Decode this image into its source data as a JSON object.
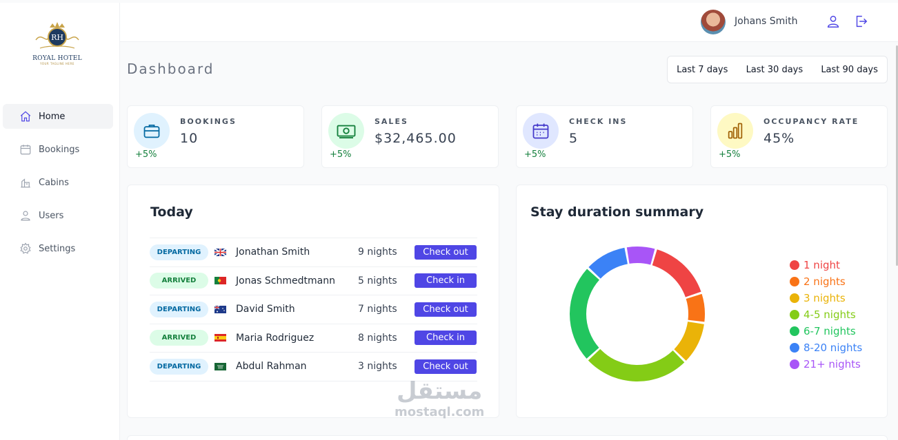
{
  "brand": {
    "name": "ROYAL HOTEL",
    "monogram": "RH",
    "tagline": "YOUR TAGLINE HERE"
  },
  "sidebar": {
    "items": [
      {
        "label": "Home",
        "icon": "home-icon",
        "active": true
      },
      {
        "label": "Bookings",
        "icon": "calendar-icon",
        "active": false
      },
      {
        "label": "Cabins",
        "icon": "cabin-icon",
        "active": false
      },
      {
        "label": "Users",
        "icon": "user-icon",
        "active": false
      },
      {
        "label": "Settings",
        "icon": "gear-icon",
        "active": false
      }
    ]
  },
  "header": {
    "user_name": "Johans Smith"
  },
  "page": {
    "title": "Dashboard"
  },
  "filters": [
    "Last 7 days",
    "Last 30 days",
    "Last 90 days"
  ],
  "stats": [
    {
      "label": "BOOKINGS",
      "value": "10",
      "change": "+5%",
      "icon": "briefcase-icon",
      "bg": "#e0f2fe",
      "fg": "#0369a1"
    },
    {
      "label": "SALES",
      "value": "$32,465.00",
      "change": "+5%",
      "icon": "banknotes-icon",
      "bg": "#dcfce7",
      "fg": "#15803d"
    },
    {
      "label": "CHECK INS",
      "value": "5",
      "change": "+5%",
      "icon": "calendar-days-icon",
      "bg": "#e0e7ff",
      "fg": "#4338ca"
    },
    {
      "label": "OCCUPANCY RATE",
      "value": "45%",
      "change": "+5%",
      "icon": "chart-bar-icon",
      "bg": "#fef9c3",
      "fg": "#a16207"
    }
  ],
  "today": {
    "title": "Today",
    "rows": [
      {
        "status": "DEPARTING",
        "flag": "uk-flag-icon",
        "name": "Jonathan Smith",
        "nights": "9 nights",
        "action": "Check out"
      },
      {
        "status": "ARRIVED",
        "flag": "portugal-flag-icon",
        "name": "Jonas Schmedtmann",
        "nights": "5 nights",
        "action": "Check in"
      },
      {
        "status": "DEPARTING",
        "flag": "australia-flag-icon",
        "name": "David Smith",
        "nights": "7 nights",
        "action": "Check out"
      },
      {
        "status": "ARRIVED",
        "flag": "spain-flag-icon",
        "name": "Maria Rodriguez",
        "nights": "8 nights",
        "action": "Check in"
      },
      {
        "status": "DEPARTING",
        "flag": "saudi-flag-icon",
        "name": "Abdul Rahman",
        "nights": "3 nights",
        "action": "Check out"
      }
    ]
  },
  "duration": {
    "title": "Stay duration summary",
    "chart_data": {
      "type": "pie",
      "title": "Stay duration summary",
      "categories": [
        "1 night",
        "2 nights",
        "3 nights",
        "4-5 nights",
        "6-7 nights",
        "8-20 nights",
        "21+ nights"
      ],
      "values": [
        15,
        7,
        10,
        25,
        23,
        10,
        7
      ],
      "colors": [
        "#ef4444",
        "#f97316",
        "#eab308",
        "#84cc16",
        "#22c55e",
        "#3b82f6",
        "#a855f7"
      ],
      "legend": "right"
    }
  },
  "watermark": {
    "arabic": "مستقل",
    "latin": "mostaql.com"
  }
}
